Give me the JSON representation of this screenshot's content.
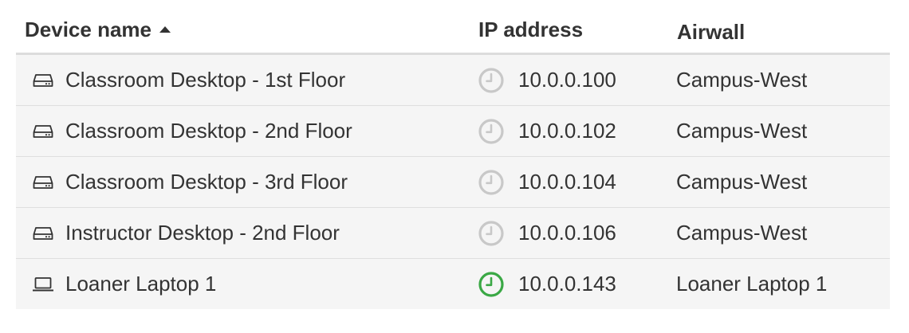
{
  "columns": {
    "name": "Device name",
    "ip": "IP address",
    "airwall": "Airwall"
  },
  "sort": {
    "column": "Device name",
    "direction": "ascending"
  },
  "status_colors": {
    "inactive": "#c8c8c8",
    "active": "#3aa845"
  },
  "rows": [
    {
      "icon": "desktop-drive-icon",
      "name": "Classroom Desktop - 1st Floor",
      "status": "inactive",
      "ip": "10.0.0.100",
      "airwall": "Campus-West"
    },
    {
      "icon": "desktop-drive-icon",
      "name": "Classroom Desktop - 2nd Floor",
      "status": "inactive",
      "ip": "10.0.0.102",
      "airwall": "Campus-West"
    },
    {
      "icon": "desktop-drive-icon",
      "name": "Classroom Desktop - 3rd Floor",
      "status": "inactive",
      "ip": "10.0.0.104",
      "airwall": "Campus-West"
    },
    {
      "icon": "desktop-drive-icon",
      "name": "Instructor Desktop - 2nd Floor",
      "status": "inactive",
      "ip": "10.0.0.106",
      "airwall": "Campus-West"
    },
    {
      "icon": "laptop-icon",
      "name": "Loaner Laptop 1",
      "status": "active",
      "ip": "10.0.0.143",
      "airwall": "Loaner Laptop 1"
    }
  ]
}
